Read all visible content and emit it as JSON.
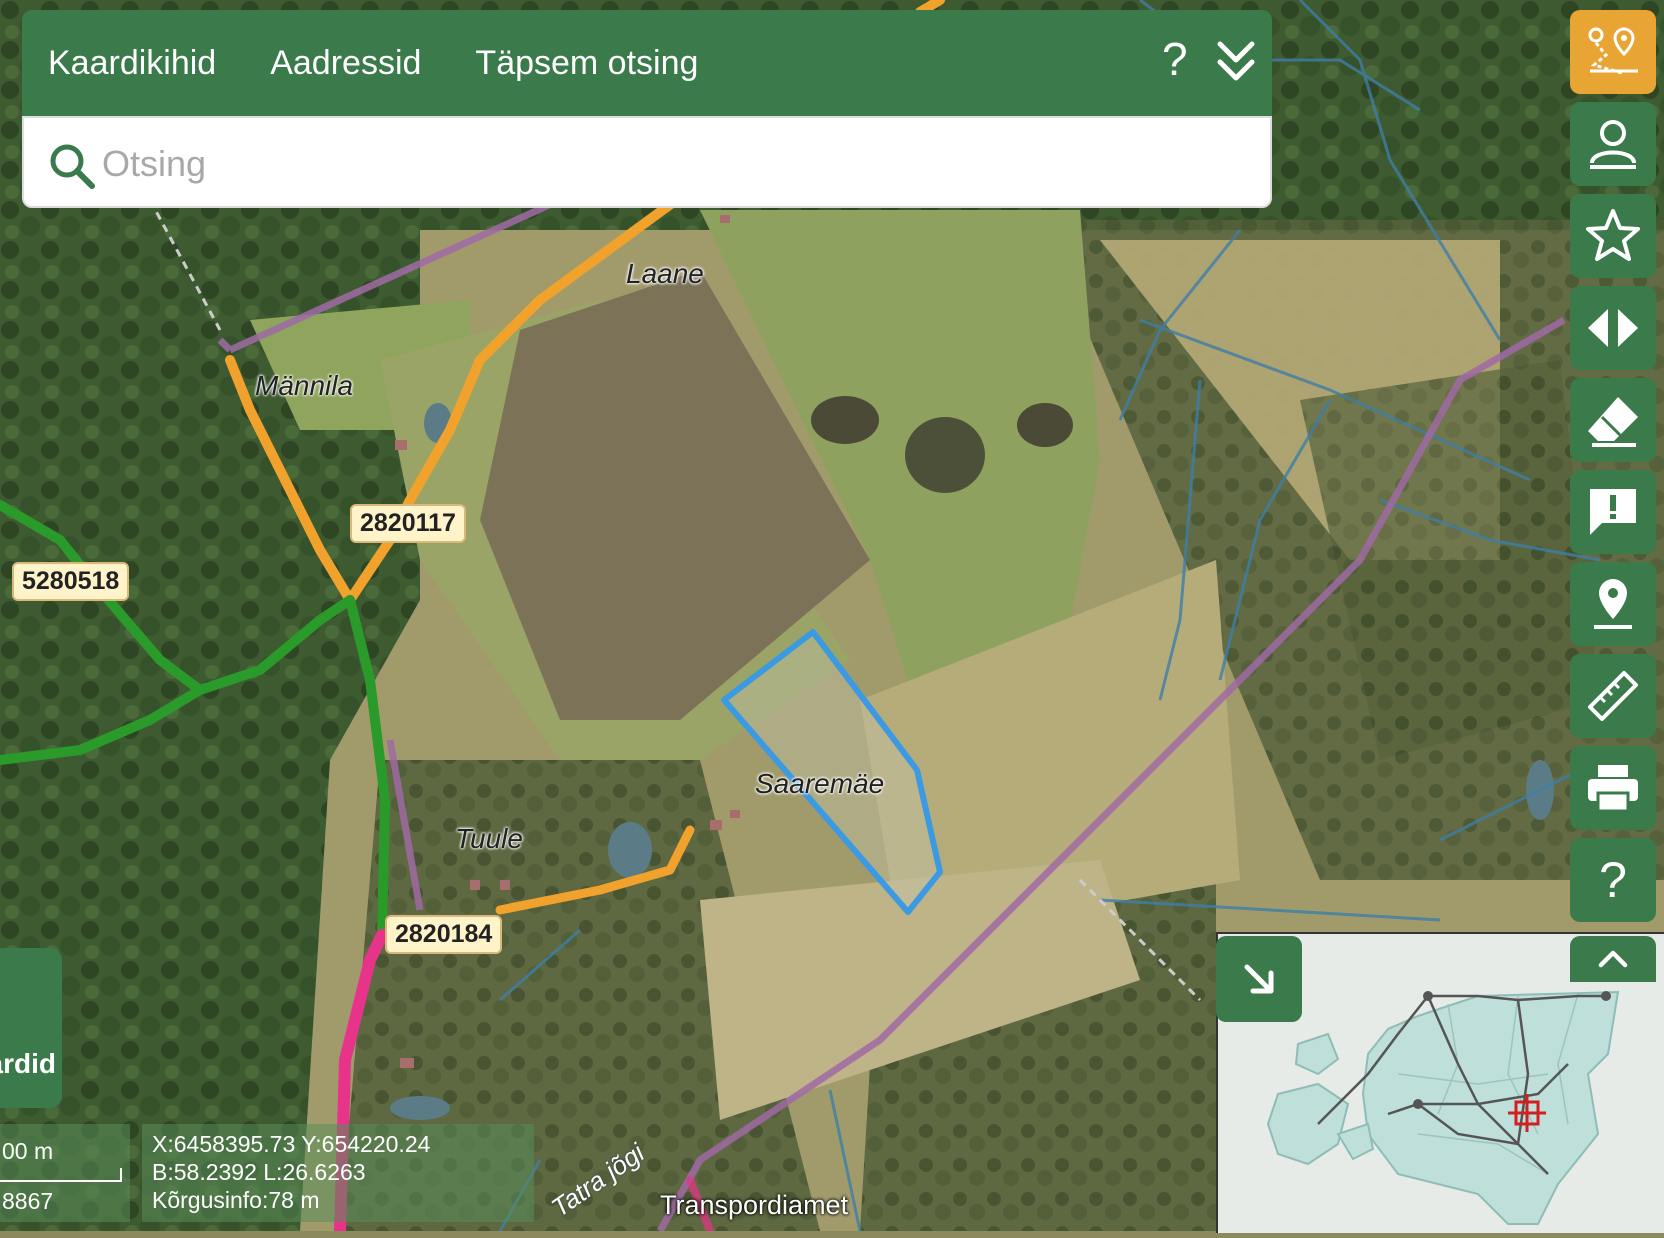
{
  "header": {
    "tabs": [
      {
        "label": "Kaardikihid"
      },
      {
        "label": "Aadressid"
      },
      {
        "label": "Täpsem otsing"
      }
    ],
    "help_label": "?"
  },
  "search": {
    "placeholder": "Otsing"
  },
  "road_labels": {
    "r1": "2820117",
    "r2": "5280518",
    "r3": "2820184"
  },
  "place_labels": {
    "p1": "Laane",
    "p2": "Männila",
    "p3": "Saaremäe",
    "p4": "Tuule"
  },
  "river_label": "Tatra jõgi",
  "toolbar": {
    "help_label": "?"
  },
  "layers_tab_label": "ardid",
  "scale": {
    "distance": "00 m",
    "ratio": "8867"
  },
  "coords": {
    "xy": "X:6458395.73 Y:654220.24",
    "bl": "B:58.2392 L:26.6263",
    "height": "Kõrgusinfo:78 m"
  },
  "attribution": "Transpordiamet",
  "colors": {
    "panel_green": "#3a7a4b",
    "active_orange": "#e9a534",
    "parcel_blue": "#3b9ae1",
    "road_orange": "#f0a22c",
    "road_green": "#2a9a2a",
    "road_pink": "#e7338a"
  }
}
